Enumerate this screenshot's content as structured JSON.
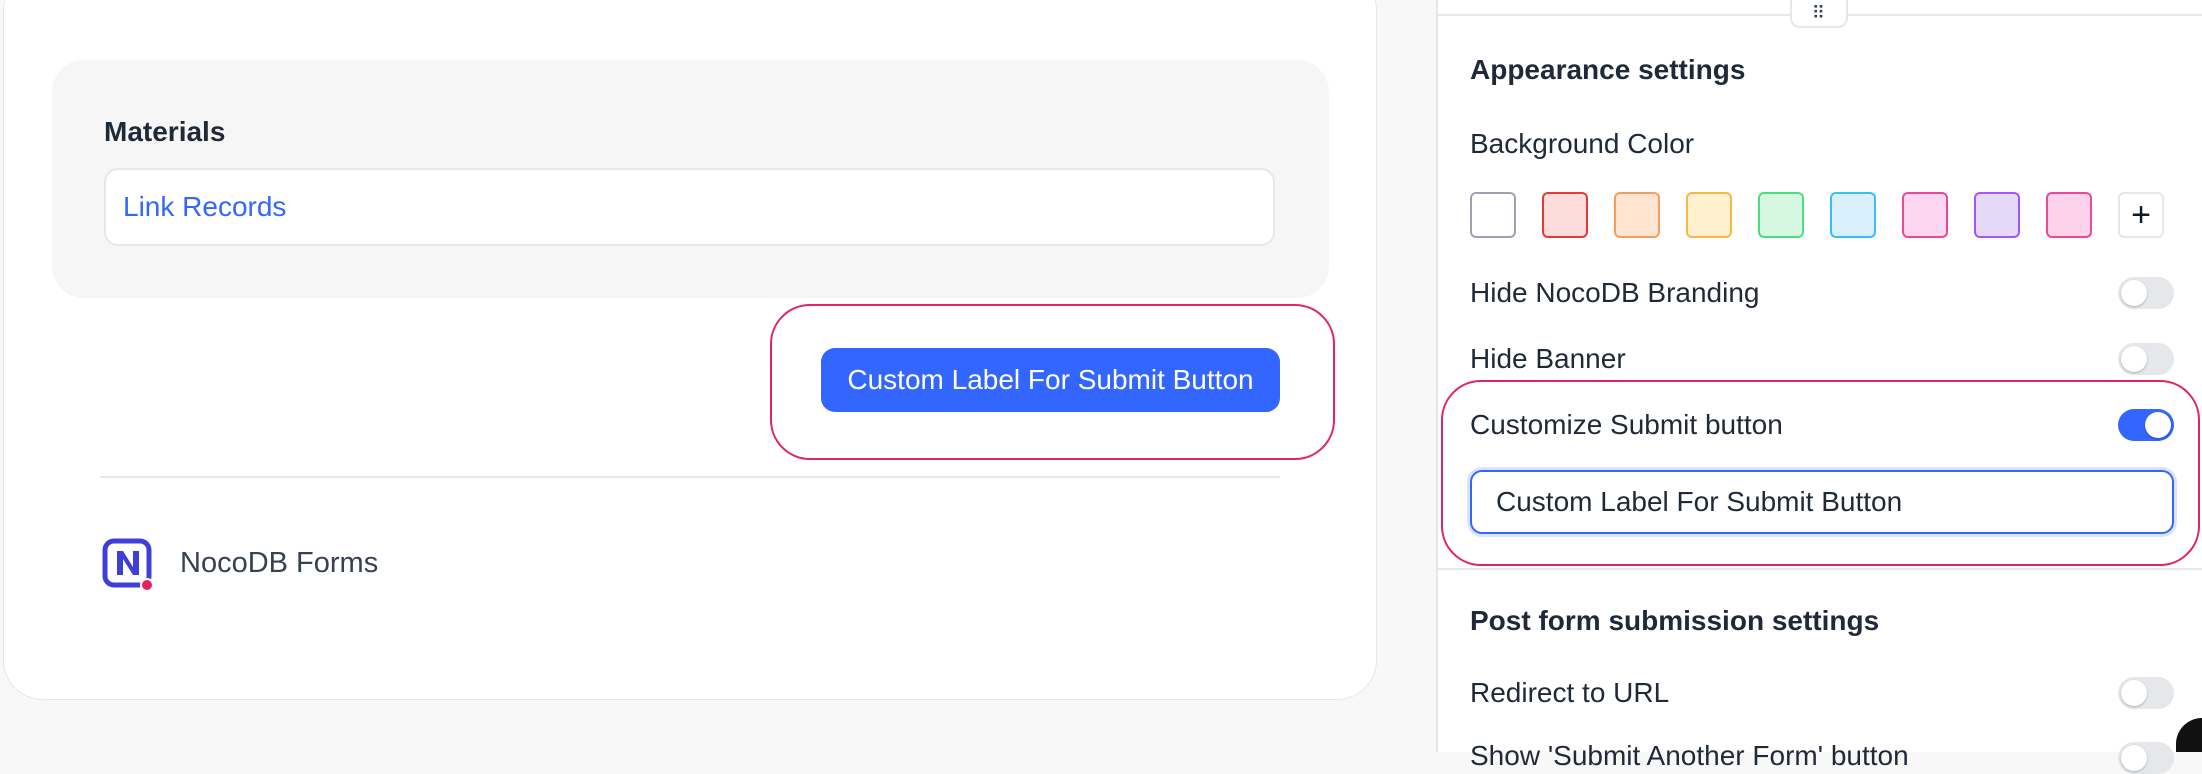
{
  "form": {
    "field_label": "Materials",
    "link_records_label": "Link Records",
    "submit_label": "Custom Label For Submit Button",
    "brand_name": "NocoDB Forms"
  },
  "settings": {
    "drag_handle_glyph": "⠿",
    "appearance_title": "Appearance settings",
    "background_color_label": "Background Color",
    "swatches": [
      {
        "fill": "#ffffff",
        "border": "#9ca3af"
      },
      {
        "fill": "#ffdcdc",
        "border": "#e53935"
      },
      {
        "fill": "#ffe4d2",
        "border": "#f59e5c"
      },
      {
        "fill": "#fff1d0",
        "border": "#f5b942"
      },
      {
        "fill": "#d6f7e0",
        "border": "#4ade80"
      },
      {
        "fill": "#d7f0fb",
        "border": "#38bdf8"
      },
      {
        "fill": "#fcd6f0",
        "border": "#ec4899"
      },
      {
        "fill": "#e6d9f7",
        "border": "#a855f7"
      },
      {
        "fill": "#fcd3ea",
        "border": "#ec4899"
      }
    ],
    "add_color_glyph": "+",
    "hide_branding_label": "Hide NocoDB Branding",
    "hide_branding_on": false,
    "hide_banner_label": "Hide Banner",
    "hide_banner_on": false,
    "customize_submit_label": "Customize Submit button",
    "customize_submit_on": true,
    "submit_label_value": "Custom Label For Submit Button",
    "post_submission_title": "Post form submission settings",
    "redirect_label": "Redirect to URL",
    "redirect_on": false,
    "show_submit_another_label": "Show 'Submit Another Form' button"
  },
  "colors": {
    "accent": "#3366ff",
    "highlight": "#e0245e",
    "logo_blue": "#3f3fd8",
    "logo_dot": "#e0245e"
  }
}
